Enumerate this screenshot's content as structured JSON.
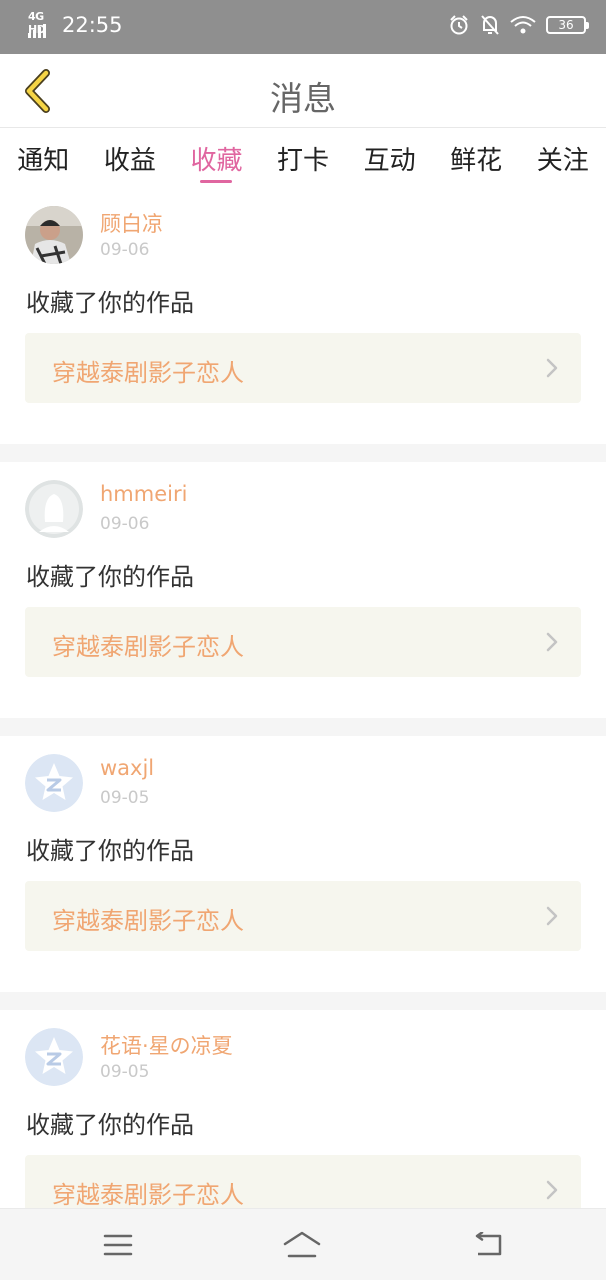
{
  "status_bar": {
    "network": "4G HD",
    "time": "22:55",
    "battery": "36"
  },
  "header": {
    "title": "消息"
  },
  "tabs": [
    {
      "label": "通知"
    },
    {
      "label": "收益"
    },
    {
      "label": "收藏",
      "active": true
    },
    {
      "label": "打卡"
    },
    {
      "label": "互动"
    },
    {
      "label": "鲜花"
    },
    {
      "label": "关注"
    }
  ],
  "items": [
    {
      "username": "顾白凉",
      "date": "09-06",
      "action": "收藏了你的作品",
      "work": "穿越泰剧影子恋人",
      "avatar": "user-photo"
    },
    {
      "username": "hmmeiri",
      "date": "09-06",
      "action": "收藏了你的作品",
      "work": "穿越泰剧影子恋人",
      "avatar": "default-silhouette"
    },
    {
      "username": "waxjl",
      "date": "09-05",
      "action": "收藏了你的作品",
      "work": "穿越泰剧影子恋人",
      "avatar": "qzone-star"
    },
    {
      "username": "花语·星の凉夏",
      "date": "09-05",
      "action": "收藏了你的作品",
      "work": "穿越泰剧影子恋人",
      "avatar": "qzone-star"
    }
  ],
  "colors": {
    "accent": "#e066a0",
    "username": "#f0a672",
    "status_bar": "#8f8f8f",
    "card_bg": "#f6f6ee"
  }
}
